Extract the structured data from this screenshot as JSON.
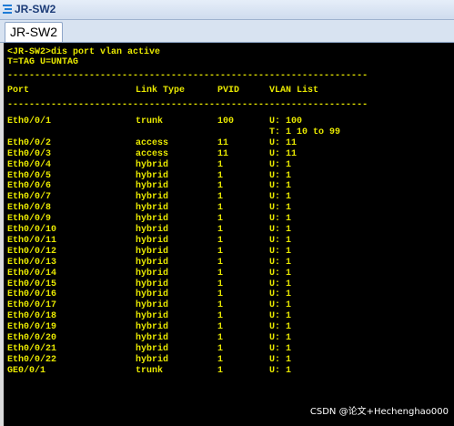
{
  "window": {
    "title": "JR-SW2",
    "tab_label": "JR-SW2",
    "icon": "network-device-icon"
  },
  "terminal": {
    "command_line": "<JR-SW2>dis port vlan active",
    "legend_line": "T=TAG U=UNTAG",
    "separator": "------------------------------------------------------------------",
    "headers": [
      "Port",
      "Link Type",
      "PVID",
      "VLAN List"
    ],
    "rows": [
      {
        "port": "Eth0/0/1",
        "link": "trunk",
        "pvid": "100",
        "vlan": "U: 100"
      },
      {
        "port": "",
        "link": "",
        "pvid": "",
        "vlan": "T: 1 10 to 99"
      },
      {
        "port": "Eth0/0/2",
        "link": "access",
        "pvid": "11",
        "vlan": "U: 11"
      },
      {
        "port": "Eth0/0/3",
        "link": "access",
        "pvid": "11",
        "vlan": "U: 11"
      },
      {
        "port": "Eth0/0/4",
        "link": "hybrid",
        "pvid": "1",
        "vlan": "U: 1"
      },
      {
        "port": "Eth0/0/5",
        "link": "hybrid",
        "pvid": "1",
        "vlan": "U: 1"
      },
      {
        "port": "Eth0/0/6",
        "link": "hybrid",
        "pvid": "1",
        "vlan": "U: 1"
      },
      {
        "port": "Eth0/0/7",
        "link": "hybrid",
        "pvid": "1",
        "vlan": "U: 1"
      },
      {
        "port": "Eth0/0/8",
        "link": "hybrid",
        "pvid": "1",
        "vlan": "U: 1"
      },
      {
        "port": "Eth0/0/9",
        "link": "hybrid",
        "pvid": "1",
        "vlan": "U: 1"
      },
      {
        "port": "Eth0/0/10",
        "link": "hybrid",
        "pvid": "1",
        "vlan": "U: 1"
      },
      {
        "port": "Eth0/0/11",
        "link": "hybrid",
        "pvid": "1",
        "vlan": "U: 1"
      },
      {
        "port": "Eth0/0/12",
        "link": "hybrid",
        "pvid": "1",
        "vlan": "U: 1"
      },
      {
        "port": "Eth0/0/13",
        "link": "hybrid",
        "pvid": "1",
        "vlan": "U: 1"
      },
      {
        "port": "Eth0/0/14",
        "link": "hybrid",
        "pvid": "1",
        "vlan": "U: 1"
      },
      {
        "port": "Eth0/0/15",
        "link": "hybrid",
        "pvid": "1",
        "vlan": "U: 1"
      },
      {
        "port": "Eth0/0/16",
        "link": "hybrid",
        "pvid": "1",
        "vlan": "U: 1"
      },
      {
        "port": "Eth0/0/17",
        "link": "hybrid",
        "pvid": "1",
        "vlan": "U: 1"
      },
      {
        "port": "Eth0/0/18",
        "link": "hybrid",
        "pvid": "1",
        "vlan": "U: 1"
      },
      {
        "port": "Eth0/0/19",
        "link": "hybrid",
        "pvid": "1",
        "vlan": "U: 1"
      },
      {
        "port": "Eth0/0/20",
        "link": "hybrid",
        "pvid": "1",
        "vlan": "U: 1"
      },
      {
        "port": "Eth0/0/21",
        "link": "hybrid",
        "pvid": "1",
        "vlan": "U: 1"
      },
      {
        "port": "Eth0/0/22",
        "link": "hybrid",
        "pvid": "1",
        "vlan": "U: 1"
      },
      {
        "port": "GE0/0/1",
        "link": "trunk",
        "pvid": "1",
        "vlan": "U: 1"
      }
    ]
  },
  "watermark": "CSDN @论文+Hechenghao000",
  "colors": {
    "terminal_bg": "#000000",
    "terminal_text": "#e8e800",
    "titlebar": "#cfdcee"
  }
}
